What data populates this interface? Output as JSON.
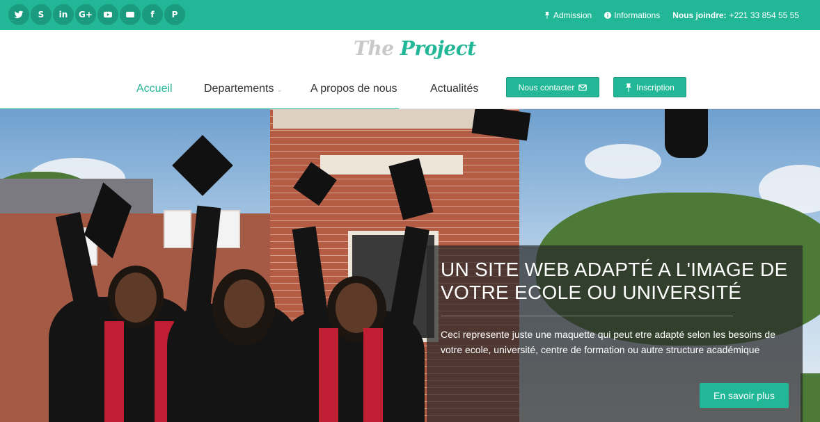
{
  "social": [
    {
      "icon": "twitter-icon",
      "glyph": ""
    },
    {
      "icon": "skype-icon",
      "glyph": "S"
    },
    {
      "icon": "linkedin-icon",
      "glyph": "in"
    },
    {
      "icon": "google-plus-icon",
      "glyph": "G+"
    },
    {
      "icon": "youtube-icon",
      "glyph": ""
    },
    {
      "icon": "flickr-icon",
      "glyph": ""
    },
    {
      "icon": "facebook-icon",
      "glyph": "f"
    },
    {
      "icon": "pinterest-icon",
      "glyph": "P"
    }
  ],
  "topbar": {
    "admission": "Admission",
    "informations": "Informations",
    "contact_label": "Nous joindre:",
    "contact_phone": "+221 33 854 55 55"
  },
  "logo": {
    "part1": "The",
    "part2": "Project"
  },
  "nav": {
    "items": [
      {
        "label": "Accueil"
      },
      {
        "label": "Departements",
        "chevron": "⌄"
      },
      {
        "label": "A propos de nous"
      },
      {
        "label": "Actualités"
      }
    ],
    "contact_button": "Nous contacter",
    "signup_button": "Inscription"
  },
  "hero": {
    "title": "UN SITE WEB ADAPTÉ A L'IMAGE DE VOTRE ECOLE OU UNIVERSITÉ",
    "text": "Ceci represente juste une maquette qui peut etre adapté selon les besoins de votre ecole, université, centre de formation ou autre structure académique",
    "button": "En savoir plus"
  },
  "colors": {
    "accent": "#21b797",
    "accent_dark": "#1a9a7e"
  }
}
